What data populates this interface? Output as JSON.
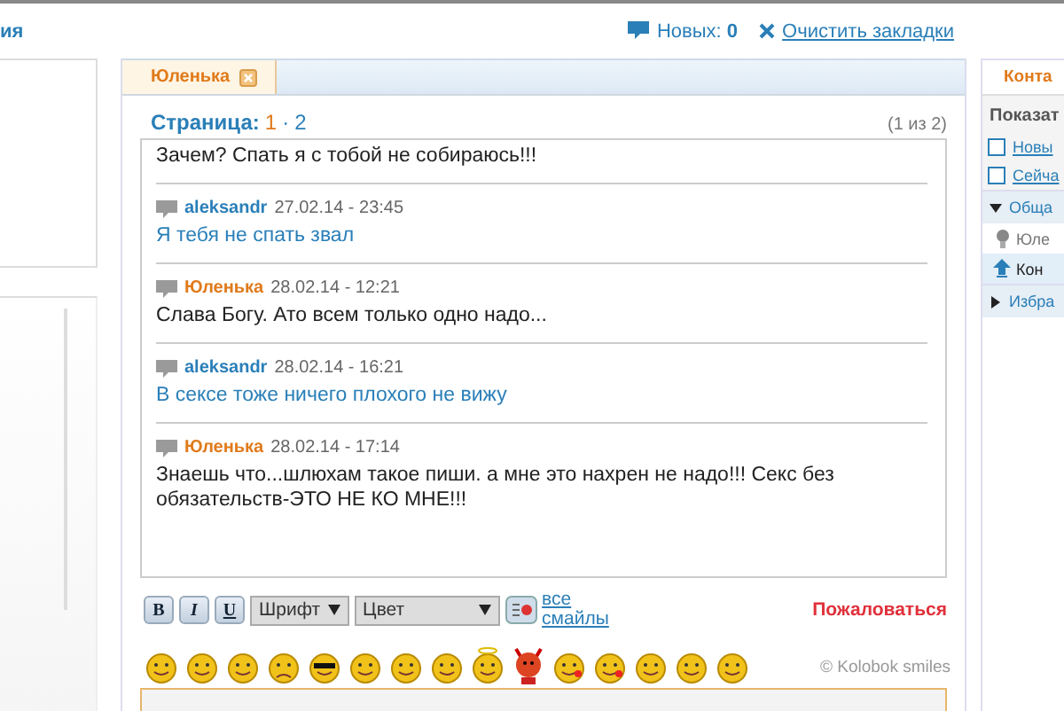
{
  "header": {
    "section_title": "ия",
    "new_label": "Новых:",
    "new_count": "0",
    "clear_link": "Очистить закладки"
  },
  "chat": {
    "tab": {
      "label": "Юленька",
      "selected": true
    },
    "pager": {
      "label": "Страница:",
      "separator": "·",
      "pages": [
        {
          "label": "1",
          "selected": true
        },
        {
          "label": "2",
          "selected": false
        }
      ],
      "count": "(1 из 2)"
    },
    "messages": [
      {
        "kind": "them",
        "text": "Зачем? Спать я с тобой не собираюсь!!!"
      },
      {
        "kind": "me",
        "author": "aleksandr",
        "time": "27.02.14 - 23:45",
        "text": "Я тебя не спать звал"
      },
      {
        "kind": "them",
        "author": "Юленька",
        "time": "28.02.14 - 12:21",
        "text": "Слава Богу. Ато всем только одно надо..."
      },
      {
        "kind": "me",
        "author": "aleksandr",
        "time": "28.02.14 - 16:21",
        "text": "В сексе тоже ничего плохого не вижу"
      },
      {
        "kind": "them",
        "author": "Юленька",
        "time": "28.02.14 - 17:14",
        "text": "Знаешь что...шлюхам такое пиши. а мне это нахрен не надо!!! Секс без обязательств-ЭТО НЕ КО МНЕ!!!"
      }
    ],
    "toolbar": {
      "bold": "B",
      "italic": "I",
      "underline": "U",
      "font": "Шрифт",
      "color_label": "Цвет",
      "all_smileys": "все смайлы",
      "report": "Пожаловаться",
      "credit": "© Kolobok smiles"
    }
  },
  "contacts": {
    "tab": "Конта",
    "show_label": "Показат",
    "filters": [
      {
        "label": "Новы",
        "checked": false
      },
      {
        "label": "Сейча",
        "checked": false
      }
    ],
    "groups": [
      {
        "label": "Обща",
        "expanded": true,
        "children": [
          {
            "label": "Юле",
            "kind": "person",
            "selected": false
          },
          {
            "label": "Кон",
            "kind": "up",
            "selected": true
          }
        ]
      },
      {
        "label": "Избра",
        "expanded": false
      }
    ]
  }
}
